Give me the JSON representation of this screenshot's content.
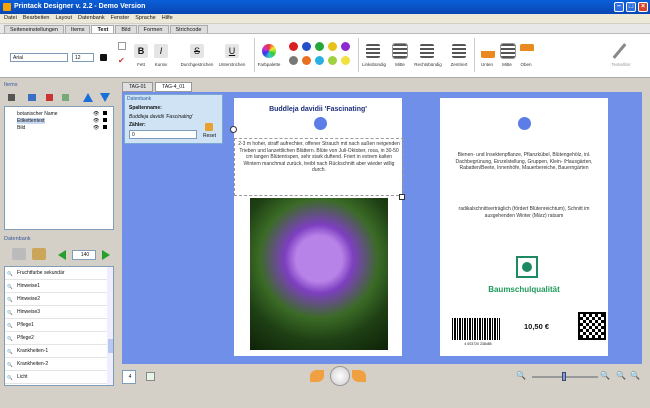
{
  "window": {
    "title": "Printack Designer  v. 2.2  - Demo Version"
  },
  "menu": [
    "Datei",
    "Bearbeiten",
    "Layout",
    "Datenbank",
    "Fenster",
    "Sprache",
    "Hilfe"
  ],
  "ribbon_tabs": [
    {
      "label": "Seiteneinstellungen",
      "active": false
    },
    {
      "label": "Items",
      "active": false
    },
    {
      "label": "Text",
      "active": true
    },
    {
      "label": "Bild",
      "active": false
    },
    {
      "label": "Formen",
      "active": false
    },
    {
      "label": "Strichcode",
      "active": false
    }
  ],
  "toolbar": {
    "font_name": "Arial",
    "font_size": "12",
    "fett": "Fett",
    "kursiv": "Kursiv",
    "durchgestrichen": "Durchgestrichen",
    "unterstrichen": "Unterstrichen",
    "farbpalette": "Farbpalette",
    "linksbuendig": "Linksbündig",
    "mitte": "Mitte",
    "rechtsbuendig": "Rechtsbündig",
    "zentriert": "Zentriert",
    "unten": "Unten",
    "mitte2": "Mitte",
    "oben": "Oben",
    "texteditor": "Texteditor",
    "colors": [
      "#d92020",
      "#2250c8",
      "#26a838",
      "#e8c21a",
      "#8a2ad0",
      "#777777",
      "#e87020",
      "#2ab0e0",
      "#a0d040",
      "#f0e040",
      "#c080e0"
    ]
  },
  "items_panel": {
    "title": "Items",
    "tree": [
      {
        "label": "botanischer Name",
        "selected": false
      },
      {
        "label": "Etikettentext",
        "selected": true
      },
      {
        "label": "Bild",
        "selected": false
      }
    ]
  },
  "datenbank_panel": {
    "title": "Datenbank",
    "record": "140",
    "fields": [
      "Fruchtfarbe sekundär",
      "Hinweise1",
      "Hinweise2",
      "Hinweise3",
      "Pflege1",
      "Pflege2",
      "Krankheiten-1",
      "Krankheiten-2",
      "Licht"
    ]
  },
  "doc_tabs": [
    {
      "label": "TAG-01",
      "active": false
    },
    {
      "label": "TAG-4_01",
      "active": true
    }
  ],
  "popup": {
    "title": "Datenbank",
    "spaltenname_label": "Spaltenname:",
    "spaltenname_value": "Buddleja davidii 'Fascinating'",
    "zaehler_label": "Zähler:",
    "zaehler_value": "0",
    "reset": "Reset"
  },
  "label_front": {
    "title": "Buddleja davidii 'Fascinating'",
    "description": "2-3 m hoher, straff aufrechter, offener Strauch mit nach außen neigenden Trieben und lanzettlichen Blättern. Blüte von Juli-Oktober, rosa, in 30-50 cm langen Blütenrispen, sehr stark duftend. Friert in extrem kalten Wintern manchmal zurück, treibt nach Rückschnitt aber wieder willig durch."
  },
  "label_back": {
    "uses": "Bienen- und Insektenpflanze, Pflanzkübel, Blütengehölz, inl. Dachbegrünung, Einzelstellung, Gruppen, Klein- /Hausgärten, Rabatten/Beete, Innenhöfe, Mauerbereiche, Bauerngärten",
    "care": "radikalschnittverträglich (fördert Blütenreichtum), Schnitt im ausgehenden Winter (März) ratsam",
    "quality": "Baumschulqualität",
    "barcode_number": "4  003720  238485",
    "price": "10,50 €"
  },
  "footer": {
    "page_count": "4"
  }
}
